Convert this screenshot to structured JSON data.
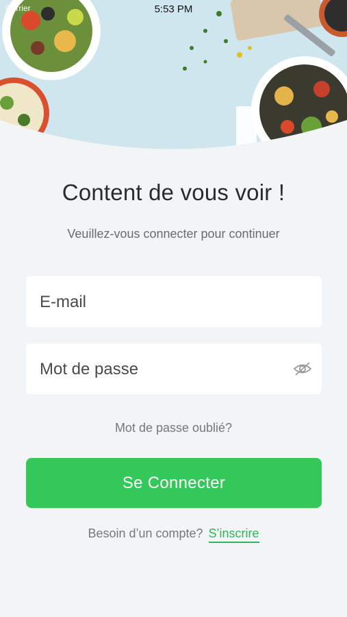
{
  "status_bar": {
    "carrier": "Carrier",
    "time": "5:53 PM"
  },
  "login": {
    "title": "Content de vous voir !",
    "subtitle": "Veuillez-vous connecter pour continuer",
    "email_placeholder": "E-mail",
    "password_placeholder": "Mot de passe",
    "forgot_label": "Mot de passe oublié?",
    "submit_label": "Se Connecter",
    "signup_prompt": "Besoin d’un compte?",
    "signup_link": "S’inscrire"
  },
  "colors": {
    "accent": "#34c759",
    "background": "#f3f4f6",
    "hero": "#cde4ec"
  },
  "icons": {
    "password_visibility": "eye-off-icon"
  }
}
